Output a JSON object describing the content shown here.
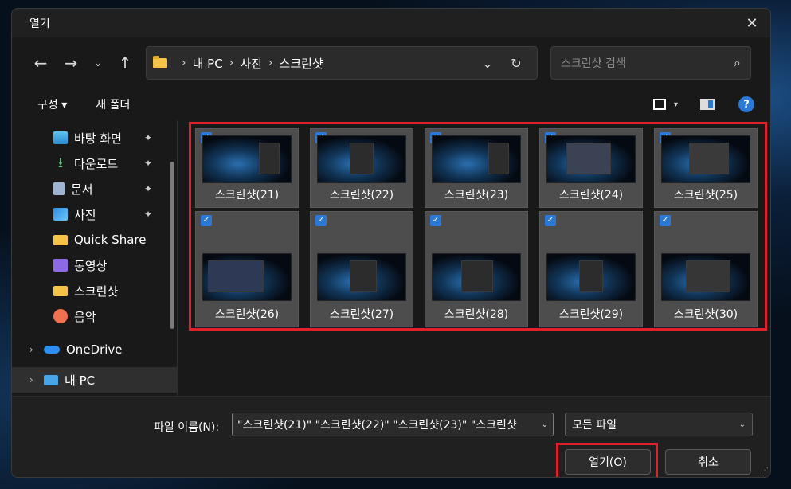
{
  "window": {
    "title": "열기",
    "close_glyph": "✕"
  },
  "nav": {
    "back": "←",
    "forward": "→",
    "recent": "⌄",
    "up": "↑",
    "breadcrumb": [
      "내 PC",
      "사진",
      "스크린샷"
    ],
    "sep": "›",
    "dropdown": "⌄",
    "refresh": "↻"
  },
  "search": {
    "placeholder": "스크린샷 검색",
    "icon": "⌕"
  },
  "commands": {
    "organize": "구성 ▾",
    "new_folder": "새 폴더",
    "help": "?"
  },
  "sidebar": {
    "items": [
      {
        "label": "바탕 화면",
        "icon": "desktop-icon",
        "pinned": true
      },
      {
        "label": "다운로드",
        "icon": "download-icon",
        "pinned": true
      },
      {
        "label": "문서",
        "icon": "document-icon",
        "pinned": true
      },
      {
        "label": "사진",
        "icon": "pictures-icon",
        "pinned": true
      },
      {
        "label": "Quick Share",
        "icon": "folder-icon",
        "pinned": false
      },
      {
        "label": "동영상",
        "icon": "video-icon",
        "pinned": false
      },
      {
        "label": "스크린샷",
        "icon": "folder-icon",
        "pinned": false
      },
      {
        "label": "음악",
        "icon": "music-icon",
        "pinned": false
      }
    ],
    "tree": [
      {
        "label": "OneDrive",
        "icon": "cloud-icon"
      },
      {
        "label": "내 PC",
        "icon": "pc-icon"
      }
    ],
    "pin_glyph": "📌",
    "chevron": "›"
  },
  "files": [
    {
      "label": "스크린샷(21)",
      "checked": true
    },
    {
      "label": "스크린샷(22)",
      "checked": true
    },
    {
      "label": "스크린샷(23)",
      "checked": true
    },
    {
      "label": "스크린샷(24)",
      "checked": true
    },
    {
      "label": "스크린샷(25)",
      "checked": true
    },
    {
      "label": "스크린샷(26)",
      "checked": true
    },
    {
      "label": "스크린샷(27)",
      "checked": true
    },
    {
      "label": "스크린샷(28)",
      "checked": true
    },
    {
      "label": "스크린샷(29)",
      "checked": true
    },
    {
      "label": "스크린샷(30)",
      "checked": true
    }
  ],
  "footer": {
    "filename_label": "파일 이름(N):",
    "filename_value": "\"스크린샷(21)\" \"스크린샷(22)\" \"스크린샷(23)\" \"스크린샷",
    "filetype": "모든 파일",
    "open": "열기(O)",
    "cancel": "취소"
  },
  "colors": {
    "accent": "#2a79d4",
    "highlight": "#e0202a"
  }
}
